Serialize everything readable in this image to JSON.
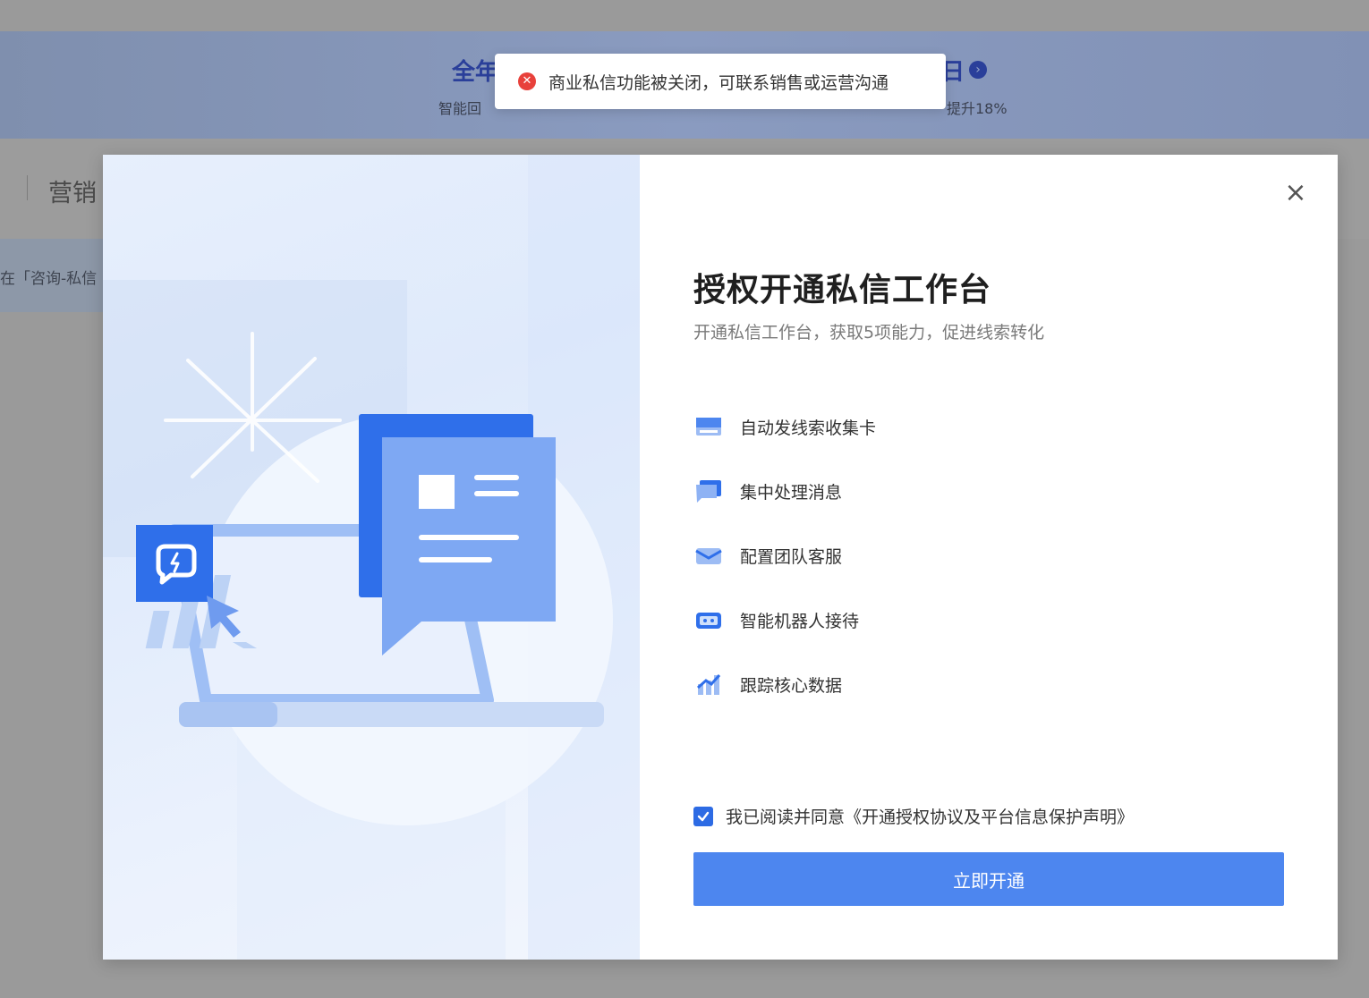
{
  "background": {
    "banner_title_start": "全年",
    "banner_title_end": "日",
    "banner_sub_start": "智能回",
    "banner_sub_end": "提升18%",
    "nav_text": "营销",
    "info_text": "在「咨询-私信"
  },
  "toast": {
    "icon": "error-icon",
    "message": "商业私信功能被关闭，可联系销售或运营沟通"
  },
  "modal": {
    "close_label": "×",
    "title": "授权开通私信工作台",
    "subtitle": "开通私信工作台，获取5项能力，促进线索转化",
    "features": [
      {
        "icon": "card-icon",
        "label": "自动发线索收集卡"
      },
      {
        "icon": "message-icon",
        "label": "集中处理消息"
      },
      {
        "icon": "team-service-icon",
        "label": "配置团队客服"
      },
      {
        "icon": "robot-icon",
        "label": "智能机器人接待"
      },
      {
        "icon": "data-chart-icon",
        "label": "跟踪核心数据"
      }
    ],
    "agreement": {
      "checked": true,
      "prefix": "我已阅读并同意",
      "link": "《开通授权协议及平台信息保护声明》"
    },
    "submit_label": "立即开通"
  },
  "colors": {
    "accent": "#4d86ef",
    "checkbox": "#2d6be4",
    "error": "#e8413b",
    "illustration_blue": "#2f6fea"
  }
}
